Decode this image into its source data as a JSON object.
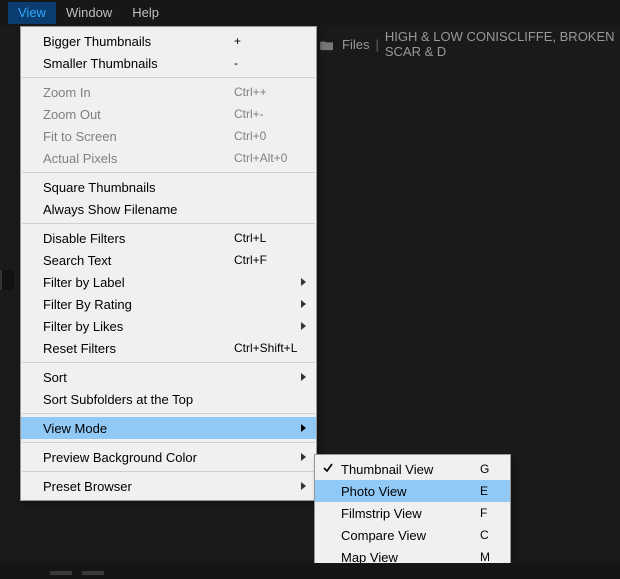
{
  "menubar": {
    "items": [
      {
        "label": "View",
        "active": true
      },
      {
        "label": "Window",
        "active": false
      },
      {
        "label": "Help",
        "active": false
      }
    ]
  },
  "breadcrumb": {
    "segments": [
      {
        "label": "Files"
      },
      {
        "label": "HIGH & LOW CONISCLIFFE, BROKEN SCAR & D"
      }
    ]
  },
  "menu": {
    "groups": [
      [
        {
          "label": "Bigger Thumbnails",
          "accel": "+",
          "enabled": true
        },
        {
          "label": "Smaller Thumbnails",
          "accel": "-",
          "enabled": true
        }
      ],
      [
        {
          "label": "Zoom In",
          "accel": "Ctrl++",
          "enabled": false
        },
        {
          "label": "Zoom Out",
          "accel": "Ctrl+-",
          "enabled": false
        },
        {
          "label": "Fit to Screen",
          "accel": "Ctrl+0",
          "enabled": false
        },
        {
          "label": "Actual Pixels",
          "accel": "Ctrl+Alt+0",
          "enabled": false
        }
      ],
      [
        {
          "label": "Square Thumbnails",
          "accel": "",
          "enabled": true
        },
        {
          "label": "Always Show Filename",
          "accel": "",
          "enabled": true
        }
      ],
      [
        {
          "label": "Disable Filters",
          "accel": "Ctrl+L",
          "enabled": true
        },
        {
          "label": "Search Text",
          "accel": "Ctrl+F",
          "enabled": true
        },
        {
          "label": "Filter by Label",
          "accel": "",
          "enabled": true,
          "submenu": true
        },
        {
          "label": "Filter By Rating",
          "accel": "",
          "enabled": true,
          "submenu": true
        },
        {
          "label": "Filter by Likes",
          "accel": "",
          "enabled": true,
          "submenu": true
        },
        {
          "label": "Reset Filters",
          "accel": "Ctrl+Shift+L",
          "enabled": true
        }
      ],
      [
        {
          "label": "Sort",
          "accel": "",
          "enabled": true,
          "submenu": true
        },
        {
          "label": "Sort Subfolders at the Top",
          "accel": "",
          "enabled": true
        }
      ],
      [
        {
          "label": "View Mode",
          "accel": "",
          "enabled": true,
          "submenu": true,
          "highlight": true
        }
      ],
      [
        {
          "label": "Preview Background Color",
          "accel": "",
          "enabled": true,
          "submenu": true
        }
      ],
      [
        {
          "label": "Preset Browser",
          "accel": "",
          "enabled": true,
          "submenu": true
        }
      ]
    ]
  },
  "submenu_viewmode": {
    "items": [
      {
        "label": "Thumbnail View",
        "accel": "G",
        "checked": true
      },
      {
        "label": "Photo View",
        "accel": "E",
        "highlight": true
      },
      {
        "label": "Filmstrip View",
        "accel": "F"
      },
      {
        "label": "Compare View",
        "accel": "C"
      },
      {
        "label": "Map View",
        "accel": "M"
      }
    ]
  }
}
